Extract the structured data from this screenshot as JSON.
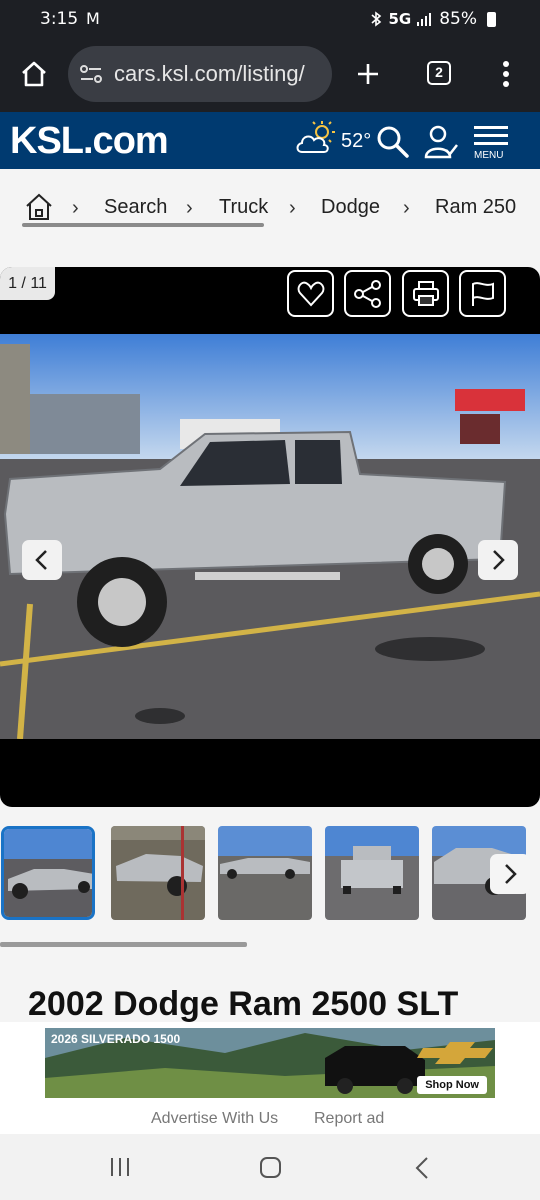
{
  "status_bar": {
    "time": "3:15",
    "mail_icon": "M",
    "network": "5G",
    "battery": "85%"
  },
  "browser": {
    "url": "cars.ksl.com/listing/",
    "tab_count": "2"
  },
  "header": {
    "logo": "KSL.com",
    "temperature": "52°",
    "menu_label": "MENU"
  },
  "breadcrumb": {
    "items": [
      "Search",
      "Truck",
      "Dodge",
      "Ram 250"
    ]
  },
  "gallery": {
    "counter": "1 / 11"
  },
  "listing": {
    "title": "2002 Dodge Ram 2500 SLT"
  },
  "ad": {
    "title": "2026 SILVERADO 1500",
    "cta": "Shop Now",
    "links": [
      "Advertise With Us",
      "Report ad"
    ]
  },
  "colors": {
    "header_bg": "#003a70",
    "status_bg": "#1d1f24",
    "thumb_selected": "#1a73c6"
  }
}
